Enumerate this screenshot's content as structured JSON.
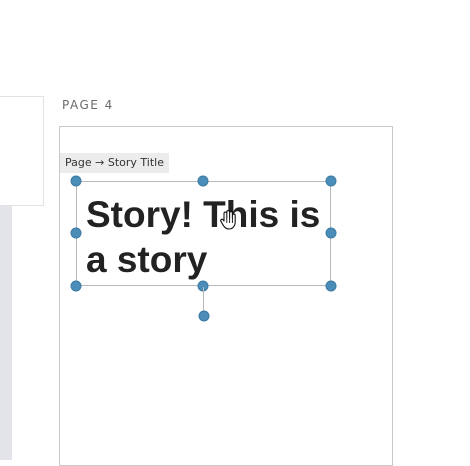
{
  "canvas": {
    "page_label": "PAGE 4"
  },
  "selection": {
    "breadcrumb": "Page → Story Title",
    "title_text": "Story! This is a story"
  },
  "icons": {
    "cursor": "hand-grab-icon"
  },
  "colors": {
    "handle": "#4a8db8",
    "selection_border": "#b8b8b8",
    "page_border": "#c9c9c9",
    "title_text": "#222222"
  }
}
